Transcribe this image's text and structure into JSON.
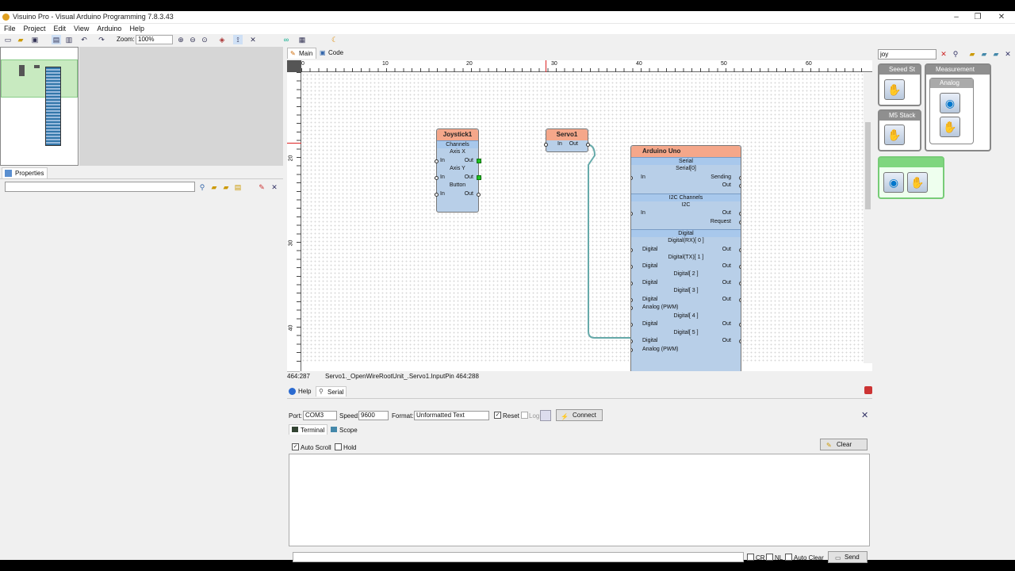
{
  "window": {
    "title": "Visuino Pro - Visual Arduino Programming 7.8.3.43",
    "controls": [
      "–",
      "❐",
      "✕"
    ]
  },
  "menu": [
    "File",
    "Project",
    "Edit",
    "View",
    "Arduino",
    "Help"
  ],
  "toolbar": {
    "zoom_label": "Zoom:",
    "zoom_value": "100%"
  },
  "properties": {
    "tab_label": "Properties"
  },
  "canvas": {
    "tabs": [
      "Main",
      "Code"
    ],
    "ruler_h": [
      "0",
      "10",
      "20",
      "30",
      "40",
      "50",
      "60"
    ],
    "ruler_v": [
      "20",
      "30",
      "40"
    ]
  },
  "components": {
    "joystick": {
      "title": "Joystick1",
      "channels": "Channels",
      "axis_x": "Axis X",
      "axis_y": "Axis Y",
      "button": "Button",
      "in": "In",
      "out": "Out"
    },
    "servo": {
      "title": "Servo1",
      "in": "In",
      "out": "Out"
    },
    "arduino": {
      "title": "Arduino Uno",
      "serial_section": "Serial",
      "serial0": "Serial[0]",
      "in": "In",
      "sending": "Sending",
      "out": "Out",
      "i2c_section": "I2C Channels",
      "i2c": "I2C",
      "request": "Request",
      "digital_section": "Digital",
      "digital_pins": [
        "Digital(RX)[ 0 ]",
        "Digital(TX)[ 1 ]",
        "Digital[ 2 ]",
        "Digital[ 3 ]",
        "Digital[ 4 ]",
        "Digital[ 5 ]"
      ],
      "digital_label": "Digital",
      "analog_pwm": "Analog (PWM)"
    }
  },
  "status_bar": {
    "coords": "464:287",
    "info": "Servo1._OpenWireRootUnit_.Servo1.InputPin 464:288"
  },
  "serial_panel": {
    "tabs": [
      "Help",
      "Serial"
    ],
    "port_label": "Port:",
    "port_value": "COM3",
    "speed_label": "Speed:",
    "speed_value": "9600",
    "format_label": "Format:",
    "format_value": "Unformatted Text",
    "reset_label": "Reset",
    "reset_checked": true,
    "log_label": "Log",
    "connect_label": "Connect",
    "subtabs": [
      "Terminal",
      "Scope"
    ],
    "auto_scroll_label": "Auto Scroll",
    "auto_scroll_checked": true,
    "hold_label": "Hold",
    "clear_label": "Clear",
    "cr_label": "CR",
    "nl_label": "NL",
    "auto_clear_label": "Auto Clear",
    "send_label": "Send"
  },
  "palette": {
    "search_value": "joy",
    "categories": [
      "Seeed St",
      "Measurement",
      "Analog",
      "M5 Stack"
    ]
  }
}
